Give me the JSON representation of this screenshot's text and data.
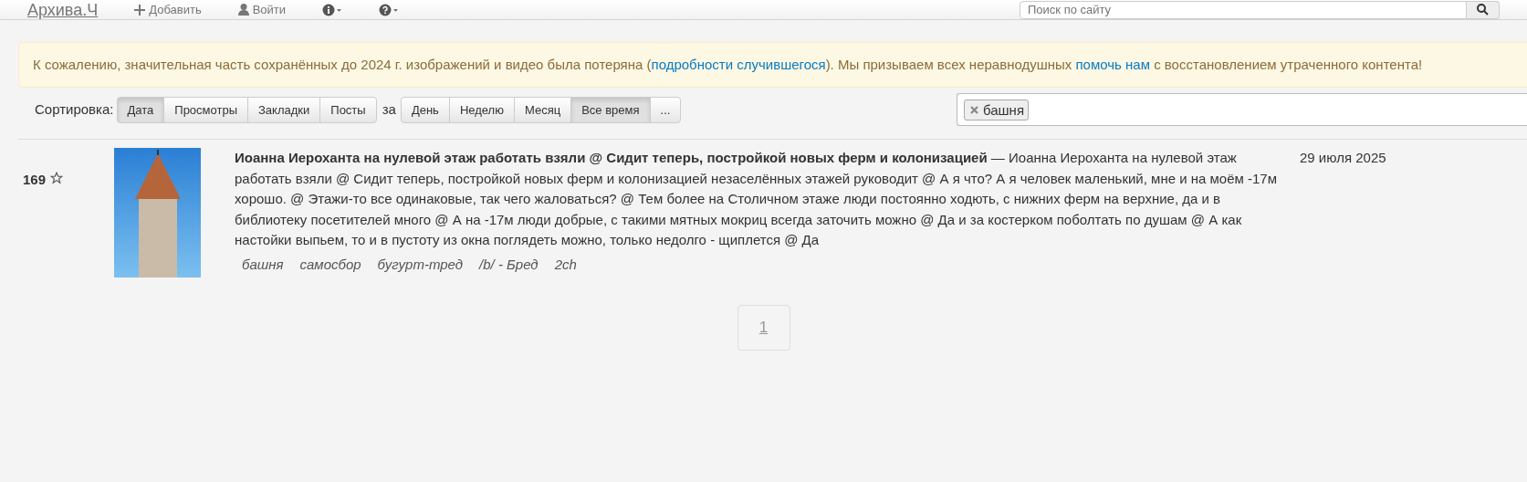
{
  "navbar": {
    "brand": "Архива.Ч",
    "items": [
      {
        "kind": "add",
        "label": "Добавить"
      },
      {
        "kind": "login",
        "label": "Войти"
      },
      {
        "kind": "info-menu"
      },
      {
        "kind": "help-menu"
      }
    ],
    "search": {
      "placeholder": "Поиск по сайту"
    }
  },
  "alert": [
    {
      "kind": "text",
      "text": "К сожалению, значительная часть сохранённых до 2024 г. изображений и видео была потеряна ("
    },
    {
      "kind": "link",
      "text": "подробности случившегося"
    },
    {
      "kind": "text",
      "text": "). Мы призываем всех неравнодушных "
    },
    {
      "kind": "link",
      "text": "помочь нам"
    },
    {
      "kind": "text",
      "text": " с восстановлением утраченного контента!"
    }
  ],
  "sort": {
    "label": "Сортировка:",
    "options": [
      {
        "label": "Дата",
        "selected": true
      },
      {
        "label": "Просмотры",
        "selected": false
      },
      {
        "label": "Закладки",
        "selected": false
      },
      {
        "label": "Посты",
        "selected": false
      }
    ],
    "period_label": "за",
    "periods": [
      {
        "label": "День",
        "selected": false
      },
      {
        "label": "Неделю",
        "selected": false
      },
      {
        "label": "Месяц",
        "selected": false
      },
      {
        "label": "Все время",
        "selected": true
      },
      {
        "label": "...",
        "selected": false
      }
    ]
  },
  "tag_filter": {
    "tags": [
      "башня"
    ]
  },
  "posts": [
    {
      "score": "169",
      "text": "**Иоанна Иероханта на нулевой этаж работать взяли @ Сидит теперь, постройкой новых ферм и колонизацией** — Иоанна Иероханта на нулевой этаж работать взяли @ Сидит теперь, постройкой новых ферм и колонизацией незаселённых этажей руководит @ А я что? А я человек маленький, мне и на моём -17м хорошо. @ Этажи-то все одинаковые, так чего жаловаться? @ Тем более на Столичном этаже люди постоянно ходють, с нижних ферм на верхние, да и в библиотеку посетителей много @ А на -17м люди добрые, с такими мятных мокриц всегда заточить можно @ Да и за костерком поболтать по душам @ А как настойки выпьем, то и в пустоту из окна поглядеть можно, только недолго - щиплется @ Да",
      "tags": [
        "башня",
        "самосбор",
        "бугурт-тред",
        "/b/ - Бред",
        "2ch"
      ],
      "date": "29 июля 2025"
    }
  ],
  "pagination": [
    {
      "label": "1",
      "selected": true
    }
  ]
}
